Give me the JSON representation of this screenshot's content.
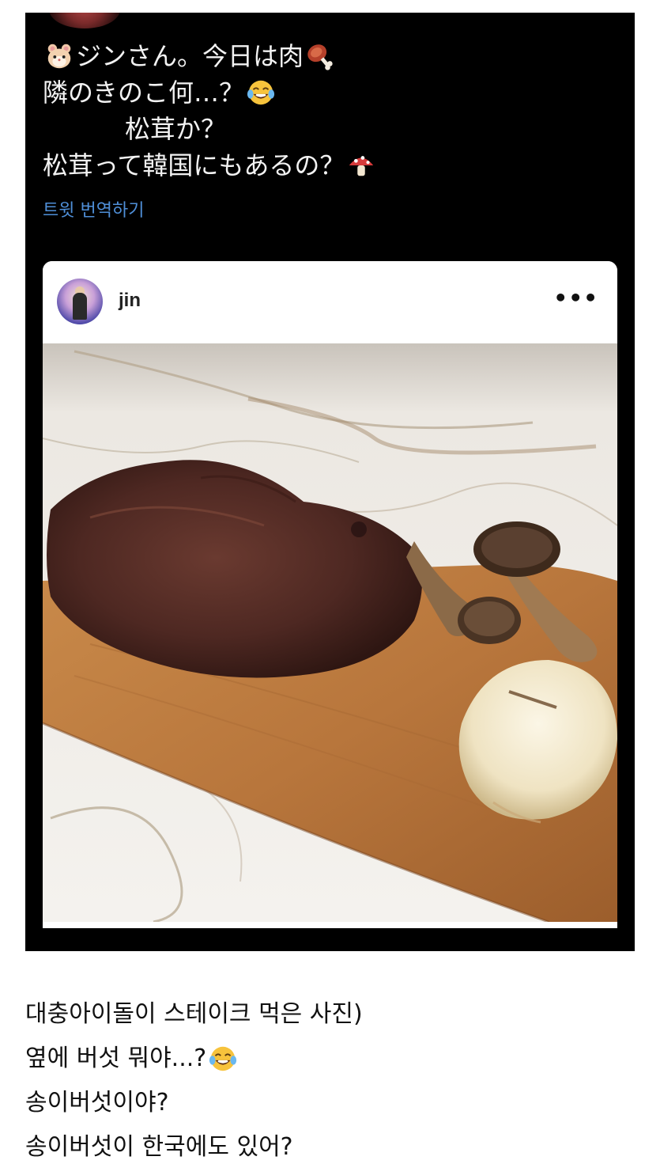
{
  "tweet": {
    "lines": [
      {
        "text": "ジンさん。今日は肉",
        "lead_emoji": "hamster-icon",
        "trail_emoji": "meat-on-bone-icon"
      },
      {
        "text": "隣のきのこ何…？",
        "trail_emoji": "tears-of-joy-icon"
      },
      {
        "text": "松茸か？"
      },
      {
        "text": "松茸って韓国にもあるの？",
        "trail_emoji": "mushroom-icon"
      }
    ],
    "translate_label": "트윗 번역하기"
  },
  "embed": {
    "username": "jin",
    "more_label": "•••"
  },
  "caption": {
    "lines": [
      {
        "text": "대충아이돌이 스테이크 먹은 사진)"
      },
      {
        "text": "옆에 버섯 뭐야...?",
        "trail_emoji": "tears-of-joy-icon"
      },
      {
        "text": "송이버섯이야?"
      },
      {
        "text": "송이버섯이 한국에도 있어?"
      }
    ]
  },
  "colors": {
    "tweet_bg": "#000000",
    "tweet_text": "#f2f2f2",
    "link": "#4f8fd8",
    "page_bg": "#ffffff"
  }
}
